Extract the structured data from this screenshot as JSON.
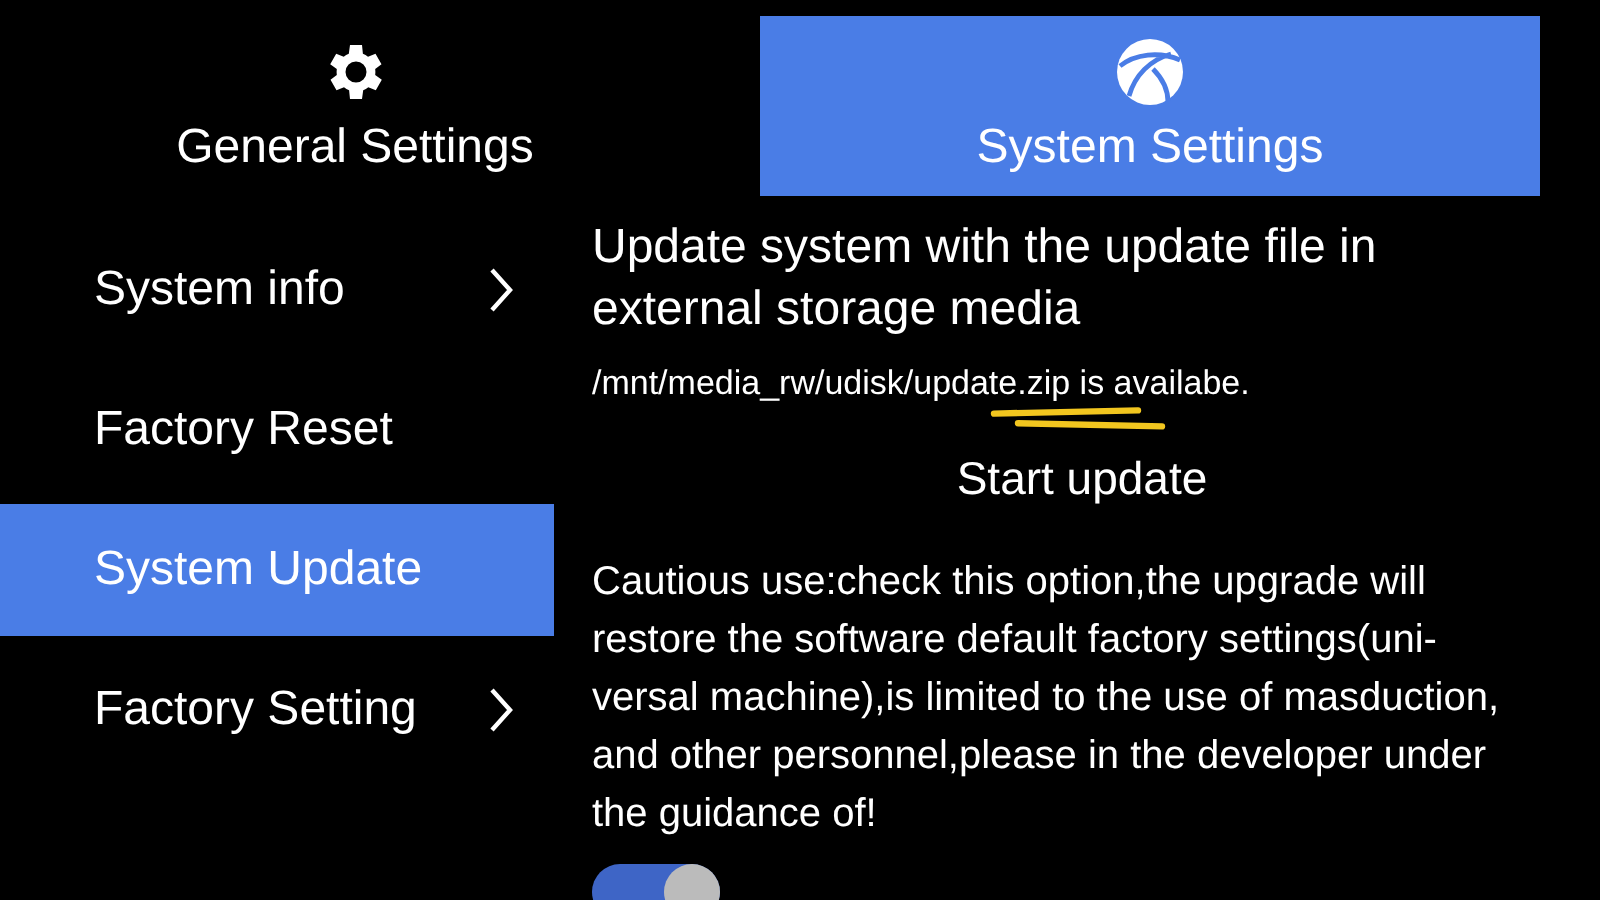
{
  "tabs": [
    {
      "label": "General Settings",
      "selected": false
    },
    {
      "label": "System Settings",
      "selected": true
    }
  ],
  "menu": [
    {
      "label": "System info",
      "has_arrow": true,
      "selected": false
    },
    {
      "label": "Factory Reset",
      "has_arrow": false,
      "selected": false
    },
    {
      "label": "System Update",
      "has_arrow": false,
      "selected": true
    },
    {
      "label": "Factory Setting",
      "has_arrow": true,
      "selected": false
    }
  ],
  "update": {
    "title": "Update system with the update file in external storage media",
    "file_status": "/mnt/media_rw/udisk/update.zip is availabe.",
    "start_button": "Start update",
    "warning": "Cautious use:check this option,the upgrade will restore the software default factory settings(uni-versal machine),is limited to the use of masduction, and other personnel,please in the developer under the guidance of!",
    "switch_on": true
  }
}
